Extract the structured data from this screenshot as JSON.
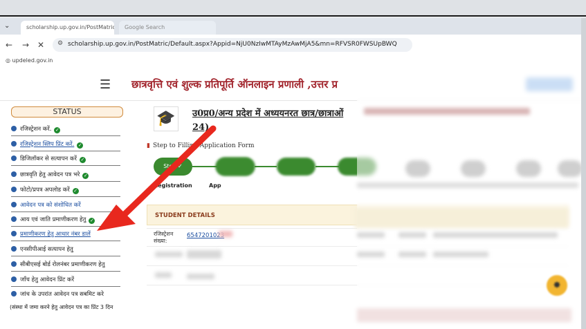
{
  "browser": {
    "tabs": [
      {
        "label": "scholarship.up.gov.in/PostMatric"
      },
      {
        "label": "Google Search"
      }
    ],
    "url": "scholarship.up.gov.in/PostMatric/Default.aspx?Appid=NjU0NzIwMTAyMzAwMjA5&mn=RFVSR0FWSUpBWQ",
    "bookmark": "updeled.gov.in"
  },
  "site": {
    "title": "छात्रवृत्ति एवं शुल्क प्रतिपूर्ति ऑनलाइन प्रणाली ,उत्तर प्र"
  },
  "sidebar": {
    "status_label": "STATUS",
    "items": [
      {
        "label": "रजिस्ट्रेशन करें.",
        "done": true
      },
      {
        "label": "रजिस्ट्रेशन स्लिप प्रिंट करें.",
        "done": true
      },
      {
        "label": "डिजिलॉकर से सत्यापन करें",
        "done": true
      },
      {
        "label": "छात्रवृति हेतु आवेदन पत्र भरे",
        "done": true
      },
      {
        "label": "फोटो/प्रपत्र अपलोड करें",
        "done": true
      },
      {
        "label": "आवेदन पत्र को संशोधित करें",
        "done": false
      },
      {
        "label": "आय एवं जाति प्रमाणीकरण हेतु",
        "done": true
      },
      {
        "label": "प्रमाणीकरण हेतु आधार नंबर डालें",
        "done": false
      },
      {
        "label": "एनसीपीआई सत्यापन हेतु",
        "done": false
      },
      {
        "label": "सीबीएसई बोर्ड रोलनंबर प्रमाणीकरण हेतु",
        "done": false
      },
      {
        "label": "जाँच हेतु आवेदन प्रिंट करें",
        "done": false
      },
      {
        "label": "जांच के उपरांत आवेदन पत्र सबमिट करे",
        "done": false
      },
      {
        "label": "(संस्था में जमा करने हेतु आवेदन पत्र का प्रिंट 3 दिन",
        "done": false
      }
    ]
  },
  "main": {
    "scheme_title_line1": "उ0प्र0/अन्य प्रदेश में अध्ययनरत छात्र/छात्राओं",
    "scheme_title_line2": "24)",
    "steps_heading": "Step to Filling Application Form",
    "steps": [
      {
        "pill": "Step",
        "label": "Registration"
      },
      {
        "pill": "",
        "label": "App"
      }
    ],
    "student_details_title": "STUDENT DETAILS",
    "registration_label_line1": "रजिस्ट्रेशन",
    "registration_label_line2": "संख्या:",
    "registration_number": "6547201023"
  },
  "colors": {
    "title_red": "#a1232b",
    "status_border": "#d08a3c",
    "done_green": "#1e8a2e",
    "step_green": "#3b8a2f",
    "arrow_red": "#e8281e",
    "link_blue": "#1d4fa0"
  }
}
